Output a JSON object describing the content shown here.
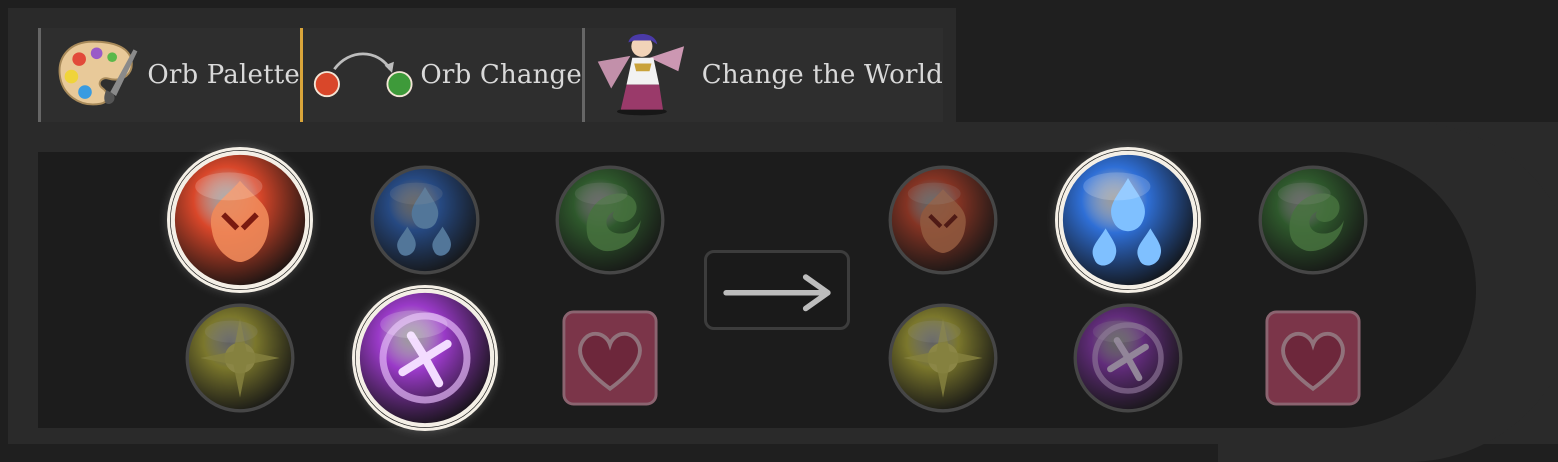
{
  "tabs": [
    {
      "label": "Orb Palette",
      "icon": "palette-icon",
      "active": false
    },
    {
      "label": "Orb Change",
      "icon": "orb-change-icon",
      "active": true
    },
    {
      "label": "Change the World",
      "icon": "character-portrait-icon",
      "active": false
    }
  ],
  "board_before": [
    {
      "type": "fire",
      "icon": "fire-orb-icon",
      "highlighted": true
    },
    {
      "type": "water",
      "icon": "water-orb-icon",
      "highlighted": false
    },
    {
      "type": "wood",
      "icon": "wood-orb-icon",
      "highlighted": false
    },
    {
      "type": "light",
      "icon": "light-orb-icon",
      "highlighted": false
    },
    {
      "type": "dark",
      "icon": "dark-orb-icon",
      "highlighted": true
    },
    {
      "type": "heart",
      "icon": "heart-orb-icon",
      "highlighted": false
    }
  ],
  "board_after": [
    {
      "type": "fire",
      "icon": "fire-orb-icon",
      "highlighted": false
    },
    {
      "type": "water",
      "icon": "water-orb-icon",
      "highlighted": true
    },
    {
      "type": "wood",
      "icon": "wood-orb-icon",
      "highlighted": false
    },
    {
      "type": "light",
      "icon": "light-orb-icon",
      "highlighted": false
    },
    {
      "type": "dark",
      "icon": "dark-orb-icon",
      "highlighted": false
    },
    {
      "type": "heart",
      "icon": "heart-orb-icon",
      "highlighted": false
    }
  ],
  "arrow": {
    "icon": "right-arrow-icon"
  },
  "colors": {
    "fire": "#d9472a",
    "water": "#2f6fd6",
    "wood": "#3e8a3a",
    "light": "#c9c23a",
    "dark": "#9a3ac8",
    "heart": "#c94a6e",
    "active_tab_accent": "#d9a53a"
  }
}
